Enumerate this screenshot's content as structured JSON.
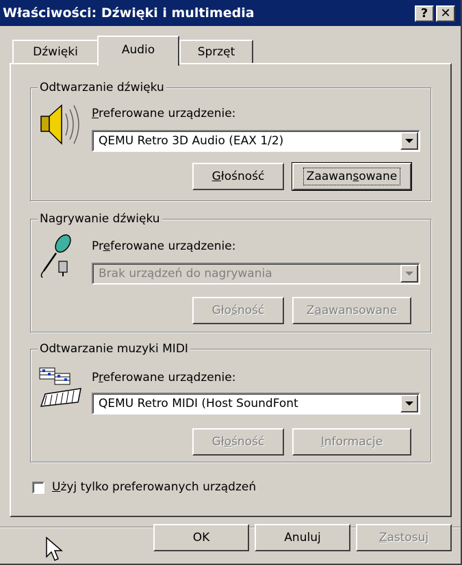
{
  "window": {
    "title": "Właściwości: Dźwięki i multimedia",
    "help_label": "?",
    "close_label": "✕",
    "title_bar_color": "#0a246a"
  },
  "tabs": [
    {
      "label": "Dźwięki",
      "selected": false
    },
    {
      "label": "Audio",
      "selected": true
    },
    {
      "label": "Sprzęt",
      "selected": false
    }
  ],
  "playback": {
    "group_label": "Odtwarzanie dźwięku",
    "icon": "speaker-icon",
    "device_label_accel": "P",
    "device_label_rest": "referowane urządzenie:",
    "device_value": "QEMU Retro 3D Audio (EAX 1/2)",
    "volume_button_accel": "G",
    "volume_button_rest": "łośność",
    "advanced_button_pre": "Zaawan",
    "advanced_button_accel": "s",
    "advanced_button_post": "owane"
  },
  "recording": {
    "group_label": "Nagrywanie dźwięku",
    "icon": "microphone-icon",
    "device_label_pre": "Pr",
    "device_label_accel": "e",
    "device_label_post": "ferowane urządzenie:",
    "device_value": "Brak urządzeń do nagrywania",
    "volume_button_pre": "Gło",
    "volume_button_accel": "ś",
    "volume_button_post": "ność",
    "advanced_button_pre": "Z",
    "advanced_button_accel": "a",
    "advanced_button_post": "awansowane"
  },
  "midi": {
    "group_label": "Odtwarzanie muzyki MIDI",
    "icon": "midi-keyboard-icon",
    "device_label_pre": "P",
    "device_label_accel": "r",
    "device_label_post": "eferowane urządzenie:",
    "device_value": "QEMU Retro MIDI (Host SoundFont",
    "volume_button_pre": "Gł",
    "volume_button_accel": "o",
    "volume_button_post": "śność",
    "info_button_accel": "I",
    "info_button_rest": "nformacje"
  },
  "preferred_only": {
    "label_accel": "U",
    "label_rest": "żyj tylko preferowanych urządzeń",
    "checked": false
  },
  "footer": {
    "ok_label": "OK",
    "cancel_label": "Anuluj",
    "apply_accel": "Z",
    "apply_rest": "astosuj"
  }
}
